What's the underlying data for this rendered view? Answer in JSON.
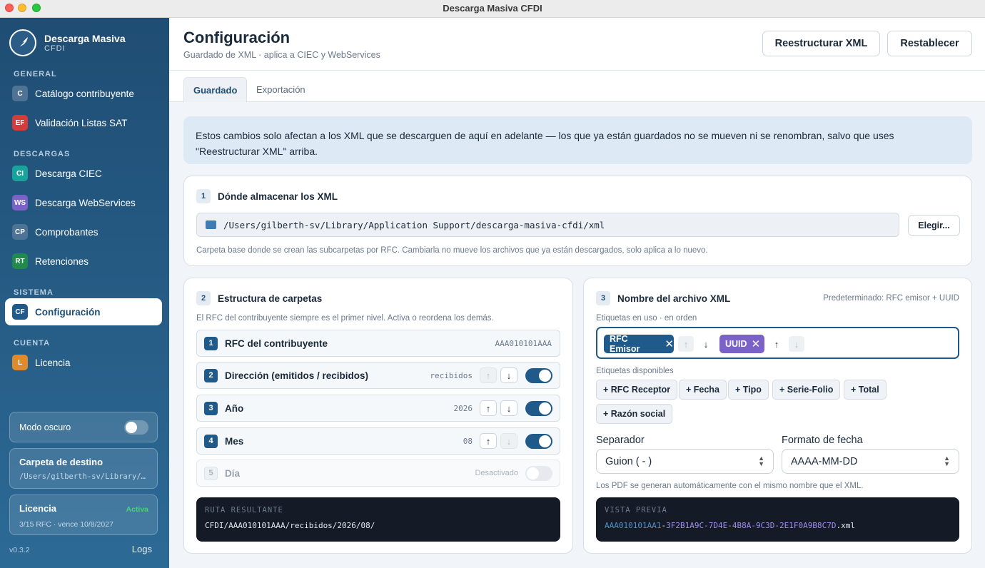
{
  "window": {
    "title": "Descarga Masiva CFDI"
  },
  "brand": {
    "name": "Descarga Masiva",
    "sub": "CFDI"
  },
  "sidebar": {
    "sections": {
      "general": "GENERAL",
      "descargas": "DESCARGAS",
      "sistema": "SISTEMA",
      "cuenta": "CUENTA"
    },
    "items": [
      {
        "badge": "C",
        "label": "Catálogo contribuyente",
        "color": "#4f7394"
      },
      {
        "badge": "EF",
        "label": "Validación Listas SAT",
        "color": "#d63a3a"
      },
      {
        "badge": "CI",
        "label": "Descarga CIEC",
        "color": "#1aa39a"
      },
      {
        "badge": "WS",
        "label": "Descarga WebServices",
        "color": "#7a62c9"
      },
      {
        "badge": "CP",
        "label": "Comprobantes",
        "color": "#4f7394"
      },
      {
        "badge": "RT",
        "label": "Retenciones",
        "color": "#1f8a4a"
      },
      {
        "badge": "CF",
        "label": "Configuración",
        "color": "#1f5a8a"
      },
      {
        "badge": "L",
        "label": "Licencia",
        "color": "#e08a2e"
      }
    ],
    "dark_mode_label": "Modo oscuro",
    "dest": {
      "title": "Carpeta de destino",
      "path": "/Users/gilberth-sv/Library/…"
    },
    "license": {
      "title": "Licencia",
      "status": "Activa",
      "detail": "3/15 RFC · vence 10/8/2027"
    },
    "version": "v0.3.2",
    "logs_label": "Logs"
  },
  "header": {
    "title": "Configuración",
    "subtitle": "Guardado de XML · aplica a CIEC y WebServices",
    "btn_restructure": "Reestructurar XML",
    "btn_reset": "Restablecer"
  },
  "tabs": [
    "Guardado",
    "Exportación"
  ],
  "info": "Estos cambios solo afectan a los XML que se descarguen de aquí en adelante — los que ya están guardados no se mueven ni se renombran, salvo que uses \"Reestructurar XML\" arriba.",
  "storage": {
    "num": "1",
    "title": "Dónde almacenar los XML",
    "path": "/Users/gilberth-sv/Library/Application Support/descarga-masiva-cfdi/xml",
    "choose": "Elegir...",
    "hint": "Carpeta base donde se crean las subcarpetas por RFC. Cambiarla no mueve los archivos que ya están descargados, solo aplica a lo nuevo."
  },
  "structure": {
    "num": "2",
    "title": "Estructura de carpetas",
    "hint": "El RFC del contribuyente siempre es el primer nivel. Activa o reordena los demás.",
    "rows": [
      {
        "n": "1",
        "label": "RFC del contribuyente",
        "value": "AAA010101AAA"
      },
      {
        "n": "2",
        "label": "Dirección (emitidos / recibidos)",
        "value": "recibidos"
      },
      {
        "n": "3",
        "label": "Año",
        "value": "2026"
      },
      {
        "n": "4",
        "label": "Mes",
        "value": "08"
      },
      {
        "n": "5",
        "label": "Día",
        "value": "Desactivado"
      }
    ],
    "result_caption": "RUTA RESULTANTE",
    "result": "CFDI/AAA010101AAA/recibidos/2026/08/"
  },
  "filename": {
    "num": "3",
    "title": "Nombre del archivo XML",
    "default_note": "Predeterminado: RFC emisor + UUID",
    "in_use_label": "Etiquetas en uso · en orden",
    "chips": [
      {
        "label": "RFC Emisor",
        "color": "#1f5a8a"
      },
      {
        "label": "UUID",
        "color": "#7a62c9"
      }
    ],
    "available_label": "Etiquetas disponibles",
    "available": [
      "+ RFC Receptor",
      "+ Fecha",
      "+ Tipo",
      "+ Serie-Folio",
      "+ Total",
      "+ Razón social"
    ],
    "separator_label": "Separador",
    "separator_value": "Guion ( - )",
    "date_format_label": "Formato de fecha",
    "date_format_value": "AAAA-MM-DD",
    "pdf_note": "Los PDF se generan automáticamente con el mismo nombre que el XML.",
    "preview_caption": "VISTA PREVIA",
    "preview_rfc": "AAA010101AA1",
    "preview_sep": "-",
    "preview_uuid": "3F2B1A9C-7D4E-4B8A-9C3D-2E1F0A9B8C7D",
    "preview_ext": ".xml"
  }
}
